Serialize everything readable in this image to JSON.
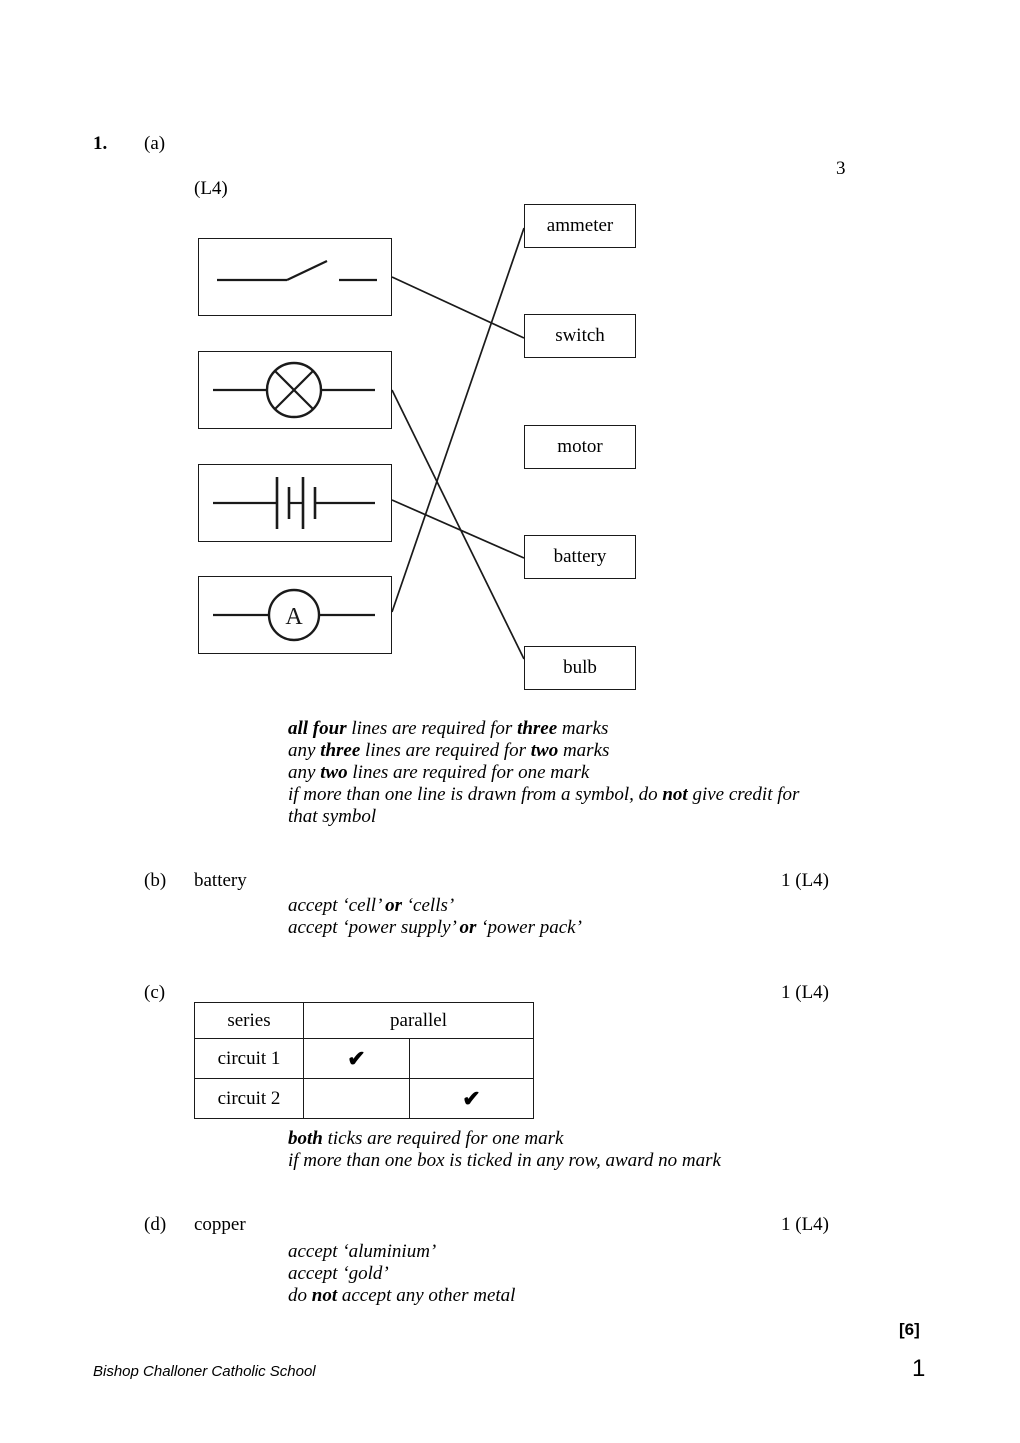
{
  "question": {
    "number": "1.",
    "part_a_label": "(a)",
    "part_a_mark": "3",
    "part_a_level": "(L4)"
  },
  "matching": {
    "symbols": [
      {
        "name": "switch-symbol",
        "icon": "switch-icon"
      },
      {
        "name": "bulb-symbol",
        "icon": "bulb-icon"
      },
      {
        "name": "battery-symbol",
        "icon": "battery-icon"
      },
      {
        "name": "ammeter-symbol",
        "icon": "ammeter-icon"
      }
    ],
    "labels": [
      "ammeter",
      "switch",
      "motor",
      "battery",
      "bulb"
    ],
    "connections": [
      {
        "from": "switch-symbol",
        "to": "switch"
      },
      {
        "from": "bulb-symbol",
        "to": "bulb"
      },
      {
        "from": "battery-symbol",
        "to": "battery"
      },
      {
        "from": "ammeter-symbol",
        "to": "ammeter"
      }
    ]
  },
  "notes": {
    "part_a": "all four lines are required for three marks\nany three lines are required for two marks\nany two lines are required for one mark\nif more than one line is drawn from a symbol, do not give credit for\nthat symbol",
    "part_a_bold": [
      "all four",
      "three",
      "two",
      "not"
    ],
    "part_b": "accept ‘cell’ or ‘cells’\naccept ‘power supply’ or ‘power pack’",
    "part_c": "both ticks are required for one mark\nif more than one box is ticked in any row, award no mark",
    "part_d": "accept ‘aluminium’\naccept ‘gold’\ndo not accept any other metal"
  },
  "part_b": {
    "label": "(b)",
    "answer": "battery",
    "mark": "1 (L4)"
  },
  "part_c": {
    "label": "(c)",
    "mark": "1 (L4)",
    "table": {
      "headers": [
        "series",
        "parallel"
      ],
      "rows": [
        {
          "label": "circuit 1",
          "series": "✔",
          "parallel": ""
        },
        {
          "label": "circuit 2",
          "series": "",
          "parallel": "✔"
        }
      ]
    }
  },
  "part_d": {
    "label": "(d)",
    "answer": "copper",
    "mark": "1 (L4)"
  },
  "footer": {
    "total": "[6]",
    "school": "Bishop Challoner Catholic School",
    "page": "1"
  }
}
